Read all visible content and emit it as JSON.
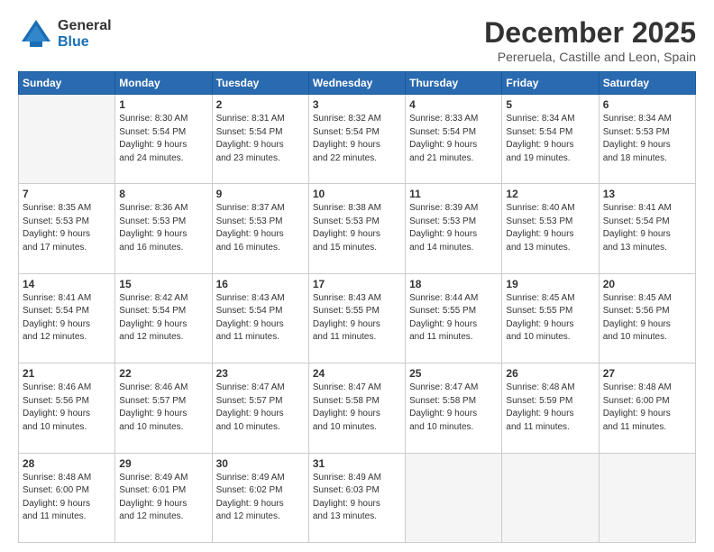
{
  "header": {
    "logo_general": "General",
    "logo_blue": "Blue",
    "month_title": "December 2025",
    "subtitle": "Pereruela, Castille and Leon, Spain"
  },
  "days_of_week": [
    "Sunday",
    "Monday",
    "Tuesday",
    "Wednesday",
    "Thursday",
    "Friday",
    "Saturday"
  ],
  "weeks": [
    [
      {
        "day": "",
        "info": ""
      },
      {
        "day": "1",
        "info": "Sunrise: 8:30 AM\nSunset: 5:54 PM\nDaylight: 9 hours\nand 24 minutes."
      },
      {
        "day": "2",
        "info": "Sunrise: 8:31 AM\nSunset: 5:54 PM\nDaylight: 9 hours\nand 23 minutes."
      },
      {
        "day": "3",
        "info": "Sunrise: 8:32 AM\nSunset: 5:54 PM\nDaylight: 9 hours\nand 22 minutes."
      },
      {
        "day": "4",
        "info": "Sunrise: 8:33 AM\nSunset: 5:54 PM\nDaylight: 9 hours\nand 21 minutes."
      },
      {
        "day": "5",
        "info": "Sunrise: 8:34 AM\nSunset: 5:54 PM\nDaylight: 9 hours\nand 19 minutes."
      },
      {
        "day": "6",
        "info": "Sunrise: 8:34 AM\nSunset: 5:53 PM\nDaylight: 9 hours\nand 18 minutes."
      }
    ],
    [
      {
        "day": "7",
        "info": "Sunrise: 8:35 AM\nSunset: 5:53 PM\nDaylight: 9 hours\nand 17 minutes."
      },
      {
        "day": "8",
        "info": "Sunrise: 8:36 AM\nSunset: 5:53 PM\nDaylight: 9 hours\nand 16 minutes."
      },
      {
        "day": "9",
        "info": "Sunrise: 8:37 AM\nSunset: 5:53 PM\nDaylight: 9 hours\nand 16 minutes."
      },
      {
        "day": "10",
        "info": "Sunrise: 8:38 AM\nSunset: 5:53 PM\nDaylight: 9 hours\nand 15 minutes."
      },
      {
        "day": "11",
        "info": "Sunrise: 8:39 AM\nSunset: 5:53 PM\nDaylight: 9 hours\nand 14 minutes."
      },
      {
        "day": "12",
        "info": "Sunrise: 8:40 AM\nSunset: 5:53 PM\nDaylight: 9 hours\nand 13 minutes."
      },
      {
        "day": "13",
        "info": "Sunrise: 8:41 AM\nSunset: 5:54 PM\nDaylight: 9 hours\nand 13 minutes."
      }
    ],
    [
      {
        "day": "14",
        "info": "Sunrise: 8:41 AM\nSunset: 5:54 PM\nDaylight: 9 hours\nand 12 minutes."
      },
      {
        "day": "15",
        "info": "Sunrise: 8:42 AM\nSunset: 5:54 PM\nDaylight: 9 hours\nand 12 minutes."
      },
      {
        "day": "16",
        "info": "Sunrise: 8:43 AM\nSunset: 5:54 PM\nDaylight: 9 hours\nand 11 minutes."
      },
      {
        "day": "17",
        "info": "Sunrise: 8:43 AM\nSunset: 5:55 PM\nDaylight: 9 hours\nand 11 minutes."
      },
      {
        "day": "18",
        "info": "Sunrise: 8:44 AM\nSunset: 5:55 PM\nDaylight: 9 hours\nand 11 minutes."
      },
      {
        "day": "19",
        "info": "Sunrise: 8:45 AM\nSunset: 5:55 PM\nDaylight: 9 hours\nand 10 minutes."
      },
      {
        "day": "20",
        "info": "Sunrise: 8:45 AM\nSunset: 5:56 PM\nDaylight: 9 hours\nand 10 minutes."
      }
    ],
    [
      {
        "day": "21",
        "info": "Sunrise: 8:46 AM\nSunset: 5:56 PM\nDaylight: 9 hours\nand 10 minutes."
      },
      {
        "day": "22",
        "info": "Sunrise: 8:46 AM\nSunset: 5:57 PM\nDaylight: 9 hours\nand 10 minutes."
      },
      {
        "day": "23",
        "info": "Sunrise: 8:47 AM\nSunset: 5:57 PM\nDaylight: 9 hours\nand 10 minutes."
      },
      {
        "day": "24",
        "info": "Sunrise: 8:47 AM\nSunset: 5:58 PM\nDaylight: 9 hours\nand 10 minutes."
      },
      {
        "day": "25",
        "info": "Sunrise: 8:47 AM\nSunset: 5:58 PM\nDaylight: 9 hours\nand 10 minutes."
      },
      {
        "day": "26",
        "info": "Sunrise: 8:48 AM\nSunset: 5:59 PM\nDaylight: 9 hours\nand 11 minutes."
      },
      {
        "day": "27",
        "info": "Sunrise: 8:48 AM\nSunset: 6:00 PM\nDaylight: 9 hours\nand 11 minutes."
      }
    ],
    [
      {
        "day": "28",
        "info": "Sunrise: 8:48 AM\nSunset: 6:00 PM\nDaylight: 9 hours\nand 11 minutes."
      },
      {
        "day": "29",
        "info": "Sunrise: 8:49 AM\nSunset: 6:01 PM\nDaylight: 9 hours\nand 12 minutes."
      },
      {
        "day": "30",
        "info": "Sunrise: 8:49 AM\nSunset: 6:02 PM\nDaylight: 9 hours\nand 12 minutes."
      },
      {
        "day": "31",
        "info": "Sunrise: 8:49 AM\nSunset: 6:03 PM\nDaylight: 9 hours\nand 13 minutes."
      },
      {
        "day": "",
        "info": ""
      },
      {
        "day": "",
        "info": ""
      },
      {
        "day": "",
        "info": ""
      }
    ]
  ]
}
